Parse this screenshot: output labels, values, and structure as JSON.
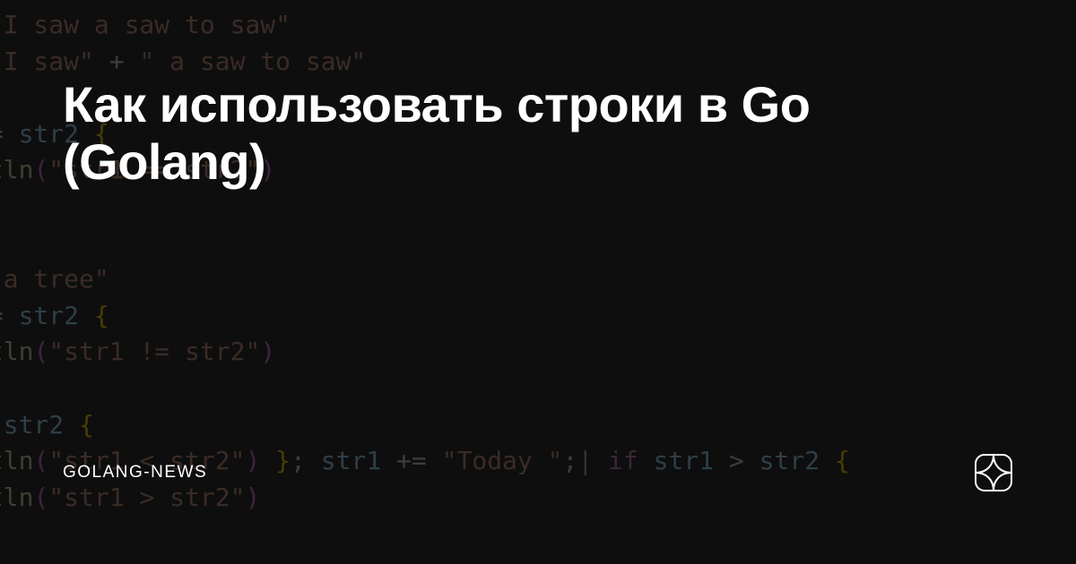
{
  "title": "Как использовать строки в Go (Golang)",
  "source": "GOLANG-NEWS",
  "code": {
    "l1_s1": "\"I saw a saw to saw\"",
    "l2_s1": "\"I saw\"",
    "l2_op": " + ",
    "l2_s2": "\" a saw to saw\"",
    "l4_op": "== ",
    "l4_v": "str2",
    "l4_b": " {",
    "l5_fn": "ntln",
    "l5_p1": "(",
    "l5_s": "\"str1 == str2\"",
    "l5_p2": ")",
    "l8_s": "\" a tree\"",
    "l9_op": "!= ",
    "l9_v": "str2",
    "l9_b": " {",
    "l10_fn": "ntln",
    "l10_p1": "(",
    "l10_s": "\"str1 != str2\"",
    "l10_p2": ")",
    "l12_op": "< ",
    "l12_v": "str2",
    "l12_b": " {",
    "l13_fn": "ntln",
    "l13_p1": "(",
    "l13_s": "\"str1 < str2\"",
    "l13_p2": ")",
    "l13_b1": " }",
    "l13_semi": "; ",
    "l13_v2": "str1",
    "l13_op2": " += ",
    "l13_s2": "\"Today \"",
    "l13_semi2": ";",
    "l13_cur": "|",
    "l13_kw": " if ",
    "l13_v3": "str1",
    "l13_op3": " > ",
    "l13_v4": "str2",
    "l13_b2": " {",
    "l14_fn": "ntln",
    "l14_p1": "(",
    "l14_s": "\"str1 > str2\"",
    "l14_p2": ")"
  }
}
